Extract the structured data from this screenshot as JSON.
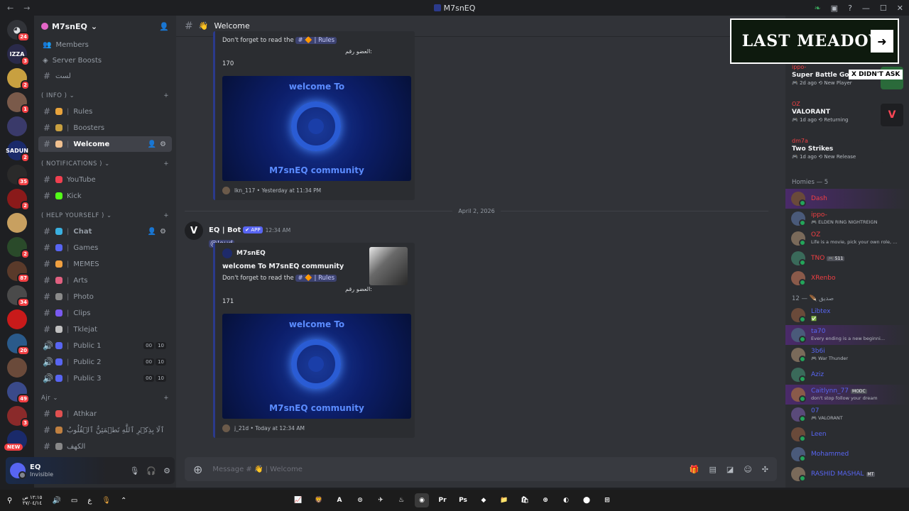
{
  "titlebar": {
    "title": "M7snEQ"
  },
  "guilds": [
    {
      "badge": "24",
      "color": "#313338"
    },
    {
      "badge": "3",
      "color": "#2a2a4a",
      "text": "IZZA"
    },
    {
      "badge": "2",
      "color": "#c8a040"
    },
    {
      "badge": "1",
      "color": "#7a5a4a"
    },
    {
      "badge": "",
      "color": "#3a3a6a"
    },
    {
      "badge": "2",
      "color": "#1a2a6a",
      "text": "SADUN"
    },
    {
      "badge": "35",
      "color": "#2a2a2a"
    },
    {
      "badge": "2",
      "color": "#8a1a1a"
    },
    {
      "badge": "",
      "color": "#c8a060"
    },
    {
      "badge": "2",
      "color": "#2a4a2a"
    },
    {
      "badge": "87",
      "color": "#5a3a2a"
    },
    {
      "badge": "34",
      "color": "#4a4a4a"
    },
    {
      "badge": "",
      "color": "#c81a1a"
    },
    {
      "badge": "20",
      "color": "#2a5a8a"
    },
    {
      "badge": "",
      "color": "#6a4a3a"
    },
    {
      "badge": "49",
      "color": "#3a4a8a"
    },
    {
      "badge": "3",
      "color": "#8a2a2a"
    },
    {
      "badge": "",
      "color": "#1a2a6a"
    }
  ],
  "guild_new": "NEW",
  "server": {
    "name": "M7snEQ",
    "top_items": [
      {
        "icon": "members-icon",
        "label": "Members"
      },
      {
        "icon": "server-boosts-icon",
        "label": "Server Boosts"
      }
    ],
    "hidden_channel": "لست",
    "categories": [
      {
        "name": "( INFO )",
        "channels": [
          {
            "type": "text",
            "label": "Rules",
            "emoji": "#e8a33c",
            "active": false,
            "rules_icon": true
          },
          {
            "type": "text",
            "label": "Boosters",
            "emoji": "#c8a040",
            "active": false
          },
          {
            "type": "text",
            "label": "Welcome",
            "emoji": "#f0c090",
            "active": true
          }
        ]
      },
      {
        "name": "( NOTIFICATIONS )",
        "channels": [
          {
            "type": "text",
            "label": "YouTube",
            "emoji": "#f04050",
            "active": false,
            "nosep": true
          },
          {
            "type": "text",
            "label": "Kick",
            "emoji": "#53fc18",
            "active": false,
            "nosep": true
          }
        ]
      },
      {
        "name": "( HELP YOURSELF )",
        "channels": [
          {
            "type": "text",
            "label": "Chat",
            "emoji": "#3ab0e0",
            "active": false,
            "hover": true
          },
          {
            "type": "text",
            "label": "Games",
            "emoji": "#5865f2",
            "active": false
          },
          {
            "type": "text",
            "label": "MEMES",
            "emoji": "#f0a040",
            "active": false
          },
          {
            "type": "text",
            "label": "Arts",
            "emoji": "#e06080",
            "active": false
          },
          {
            "type": "text",
            "label": "Photo",
            "emoji": "#8a8a8a",
            "active": false
          },
          {
            "type": "text",
            "label": "Clips",
            "emoji": "#7a5af0",
            "active": false
          },
          {
            "type": "text",
            "label": "Tklejat",
            "emoji": "#c0c0c0",
            "active": false
          },
          {
            "type": "voice",
            "label": "Public 1",
            "emoji": "#5865f2",
            "count": "00",
            "limit": "10"
          },
          {
            "type": "voice",
            "label": "Public 2",
            "emoji": "#5865f2",
            "count": "00",
            "limit": "10"
          },
          {
            "type": "voice",
            "label": "Public 3",
            "emoji": "#5865f2",
            "count": "00",
            "limit": "10"
          }
        ]
      },
      {
        "name": "Ajr",
        "channels": [
          {
            "type": "text",
            "label": "Athkar",
            "emoji": "#e05050",
            "active": false
          },
          {
            "type": "text",
            "label": "ٱلَا بِذِكۡرِ ٱللَّهِ تَطۡمَئِنُّ ٱلۡقُلُوبُ",
            "emoji": "#c08040",
            "active": false,
            "plain": true
          },
          {
            "type": "text",
            "label": "الكهف",
            "emoji": "#888888",
            "active": false,
            "plain": true
          }
        ]
      }
    ]
  },
  "user": {
    "name": "EQ",
    "status": "Invisible"
  },
  "channel_header": {
    "name": "Welcome"
  },
  "messages": [
    {
      "embed_partial": true,
      "desc_prefix": "Don't forget to read the",
      "chip": "# 🔶 | Rules",
      "arabic": "العضو رقم:",
      "number": "170",
      "banner_top": "welcome To",
      "banner_bottom": "M7snEQ community",
      "footer": "lkn_117 • Yesterday at 11:34 PM"
    }
  ],
  "date_divider": "April 2, 2026",
  "bot_message": {
    "author": "EQ | Bot",
    "badge": "✔ APP",
    "time": "12:34 AM",
    "mention": "@Joud",
    "embed": {
      "author": "M7snEQ",
      "title": "welcome To M7snEQ community",
      "desc_prefix": "Don't forget to read the",
      "chip": "# 🔶 | Rules",
      "arabic": "العضو رقم:",
      "number": "171",
      "banner_top": "welcome To",
      "banner_bottom": "M7snEQ community",
      "footer": "j_21d • Today at 12:34 AM"
    }
  },
  "composer": {
    "placeholder": "Message # 👋 | Welcome"
  },
  "activity": [
    {
      "user": "ippo-",
      "game": "Super Battle Golf",
      "time": "2d ago",
      "tag": "New Player",
      "icon_color": "#2a6a3a"
    },
    {
      "user": "OZ",
      "game": "VALORANT",
      "time": "1d ago",
      "tag": "Returning",
      "icon_color": "#1e1f22",
      "icon": "V"
    },
    {
      "user": "dm7a",
      "game": "Two Strikes",
      "time": "1d ago",
      "tag": "New Release",
      "icon_color": "#2b2d31"
    }
  ],
  "groups": [
    {
      "title": "Homies — 5",
      "members": [
        {
          "name": "Dash",
          "color": "#f23f43",
          "status": "",
          "highlight": true
        },
        {
          "name": "ippo-",
          "color": "#f23f43",
          "status": "ELDEN RING NIGHTREIGN",
          "game": true
        },
        {
          "name": "OZ",
          "color": "#f23f43",
          "status": "Life is a movie, pick your own role, ..."
        },
        {
          "name": "TNO",
          "color": "#f23f43",
          "status": "",
          "tag": "🎮 511"
        },
        {
          "name": "XRenbo",
          "color": "#f23f43",
          "status": ""
        }
      ]
    },
    {
      "title": "صديق 🪶 — 12",
      "members": [
        {
          "name": "Libtex",
          "color": "#5865f2",
          "status": "✅"
        },
        {
          "name": "ta70",
          "color": "#5865f2",
          "status": "Every ending is a new beginni...",
          "highlight": true
        },
        {
          "name": "3b6i",
          "color": "#5865f2",
          "status": "War Thunder",
          "game": true
        },
        {
          "name": "Aziz",
          "color": "#5865f2",
          "status": ""
        },
        {
          "name": "Caitlynn_77",
          "color": "#5865f2",
          "status": "don't stop follow your dream",
          "tag": "MODC",
          "highlight": true
        },
        {
          "name": "07",
          "color": "#5865f2",
          "status": "VALORANT",
          "game": true
        },
        {
          "name": "Leen",
          "color": "#5865f2",
          "status": ""
        },
        {
          "name": "Mohammed",
          "color": "#5865f2",
          "status": ""
        },
        {
          "name": "RASHID MASHAL",
          "color": "#5865f2",
          "status": "",
          "tag": "MT"
        }
      ]
    }
  ],
  "overlay": {
    "title": "LAST MEADOW",
    "arrow": "➜",
    "caption": "X DIDN'T ASK"
  },
  "taskbar": {
    "time": "١٢:١٥ ص",
    "date": "٢٧/٠٤/١٤",
    "lang": "ع",
    "apps": [
      "📈",
      "🦁",
      "A",
      "⊙",
      "✈",
      "♨",
      "◉",
      "Pr",
      "Ps",
      "◆",
      "📁",
      "🛍",
      "⊕",
      "◐",
      "⬤",
      "⊞"
    ]
  }
}
